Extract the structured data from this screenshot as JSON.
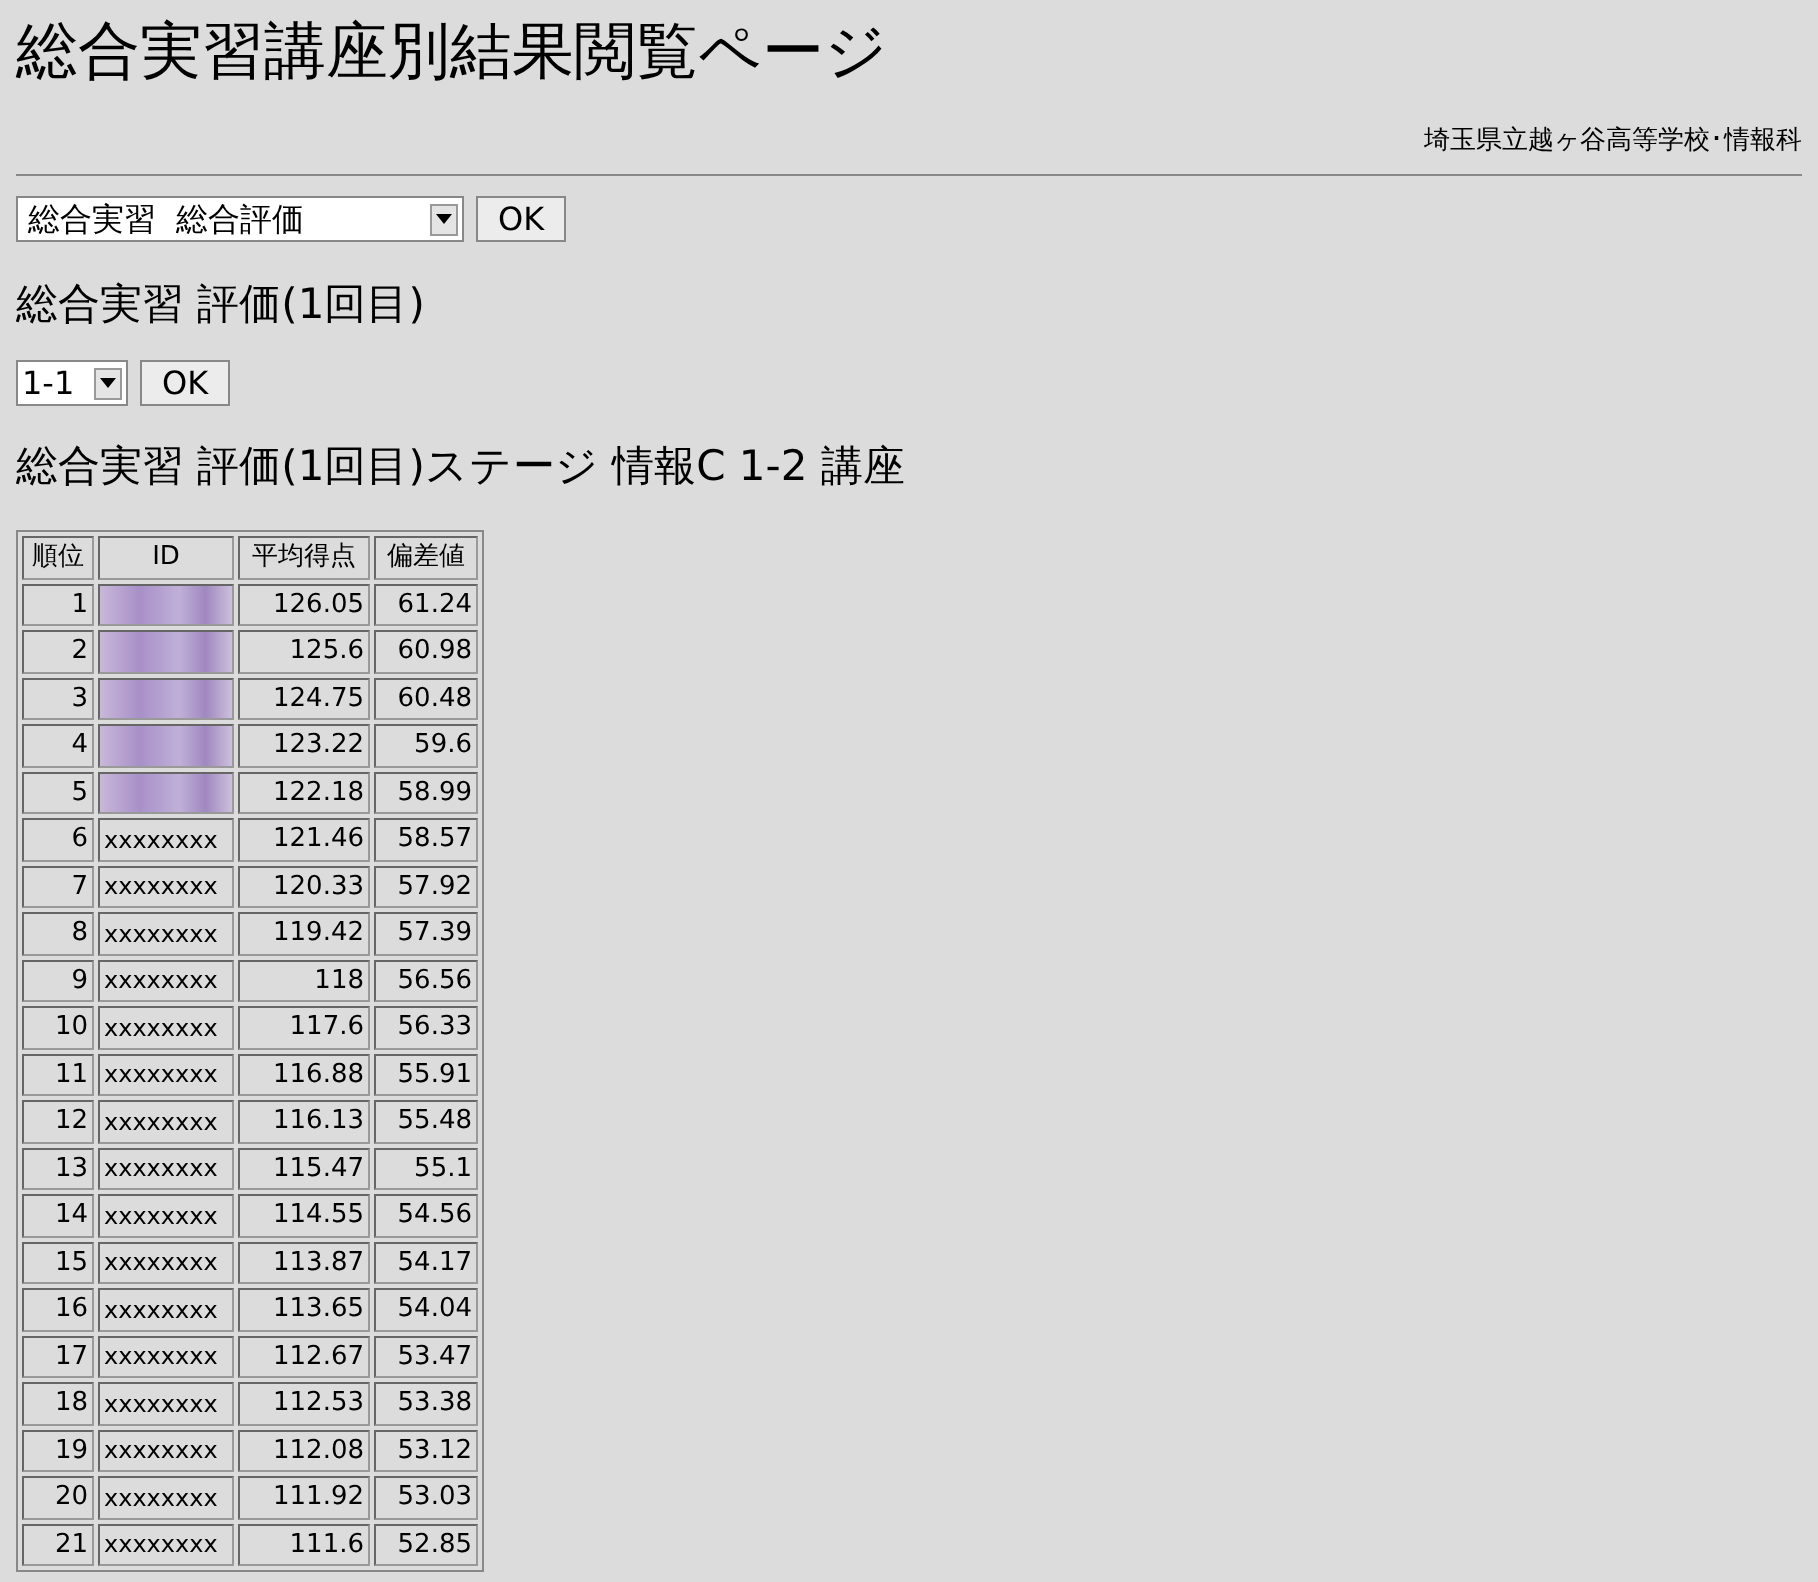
{
  "page_title": "総合実習講座別結果閲覧ページ",
  "school": "埼玉県立越ヶ谷高等学校･情報科",
  "course_select": {
    "value": "総合実習  総合評価",
    "button": "OK"
  },
  "section_title": "総合実習 評価(1回目)",
  "class_select": {
    "value": "1-1",
    "button": "OK"
  },
  "result_title": "総合実習 評価(1回目)ステージ 情報C 1-2 講座",
  "table": {
    "columns": [
      "順位",
      "ID",
      "平均得点",
      "偏差値"
    ],
    "rows": [
      {
        "kind": "redacted",
        "rank": "1",
        "score": "126.05",
        "deviation": "61.24"
      },
      {
        "kind": "redacted",
        "rank": "2",
        "score": "125.6",
        "deviation": "60.98"
      },
      {
        "kind": "redacted",
        "rank": "3",
        "score": "124.75",
        "deviation": "60.48"
      },
      {
        "kind": "redacted",
        "rank": "4",
        "score": "123.22",
        "deviation": "59.6"
      },
      {
        "kind": "redacted",
        "rank": "5",
        "score": "122.18",
        "deviation": "58.99"
      },
      {
        "kind": "plain",
        "rank": "6",
        "id": "xxxxxxxx",
        "score": "121.46",
        "deviation": "58.57"
      },
      {
        "kind": "plain",
        "rank": "7",
        "id": "xxxxxxxx",
        "score": "120.33",
        "deviation": "57.92"
      },
      {
        "kind": "plain",
        "rank": "8",
        "id": "xxxxxxxx",
        "score": "119.42",
        "deviation": "57.39"
      },
      {
        "kind": "plain",
        "rank": "9",
        "id": "xxxxxxxx",
        "score": "118",
        "deviation": "56.56"
      },
      {
        "kind": "plain",
        "rank": "10",
        "id": "xxxxxxxx",
        "score": "117.6",
        "deviation": "56.33"
      },
      {
        "kind": "plain",
        "rank": "11",
        "id": "xxxxxxxx",
        "score": "116.88",
        "deviation": "55.91"
      },
      {
        "kind": "plain",
        "rank": "12",
        "id": "xxxxxxxx",
        "score": "116.13",
        "deviation": "55.48"
      },
      {
        "kind": "plain",
        "rank": "13",
        "id": "xxxxxxxx",
        "score": "115.47",
        "deviation": "55.1"
      },
      {
        "kind": "plain",
        "rank": "14",
        "id": "xxxxxxxx",
        "score": "114.55",
        "deviation": "54.56"
      },
      {
        "kind": "plain",
        "rank": "15",
        "id": "xxxxxxxx",
        "score": "113.87",
        "deviation": "54.17"
      },
      {
        "kind": "plain",
        "rank": "16",
        "id": "xxxxxxxx",
        "score": "113.65",
        "deviation": "54.04"
      },
      {
        "kind": "plain",
        "rank": "17",
        "id": "xxxxxxxx",
        "score": "112.67",
        "deviation": "53.47"
      },
      {
        "kind": "plain",
        "rank": "18",
        "id": "xxxxxxxx",
        "score": "112.53",
        "deviation": "53.38"
      },
      {
        "kind": "plain",
        "rank": "19",
        "id": "xxxxxxxx",
        "score": "112.08",
        "deviation": "53.12"
      },
      {
        "kind": "plain",
        "rank": "20",
        "id": "xxxxxxxx",
        "score": "111.92",
        "deviation": "53.03"
      },
      {
        "kind": "plain",
        "rank": "21",
        "id": "xxxxxxxx",
        "score": "111.6",
        "deviation": "52.85"
      }
    ]
  }
}
